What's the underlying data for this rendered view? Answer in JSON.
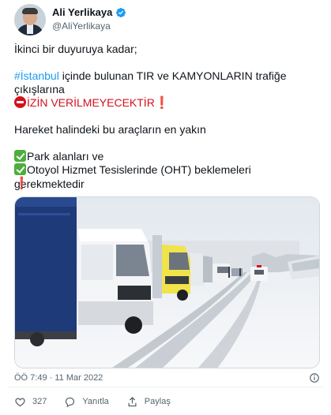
{
  "author": {
    "display_name": "Ali Yerlikaya",
    "handle": "@AliYerlikaya",
    "verified_icon": "verified-badge-icon",
    "accent_color": "#1d9bf0"
  },
  "tweet": {
    "line1": "İkinci bir duyuruya kadar;",
    "hashtag": "#İstanbul",
    "line2_rest": " içinde bulunan TIR ve KAMYONLARIN trafiğe",
    "line3": "çıkışlarına",
    "line4": "İZİN VERİLMEYECEKTİR",
    "line5": "Hareket halindeki bu araçların en yakın",
    "line6": "Park alanları ve",
    "line7": "Otoyol Hizmet Tesislerinde (OHT) beklemeleri gerekmektedir",
    "excl": "❗"
  },
  "meta": {
    "timestamp": "ÖÖ 7:49 · 11 Mar 2022"
  },
  "actions": {
    "like_count": "327",
    "reply_label": "Yanıtla",
    "share_label": "Paylaş"
  },
  "icons": {
    "like": "heart-icon",
    "reply": "reply-bubble-icon",
    "share": "share-icon",
    "info": "info-icon"
  }
}
